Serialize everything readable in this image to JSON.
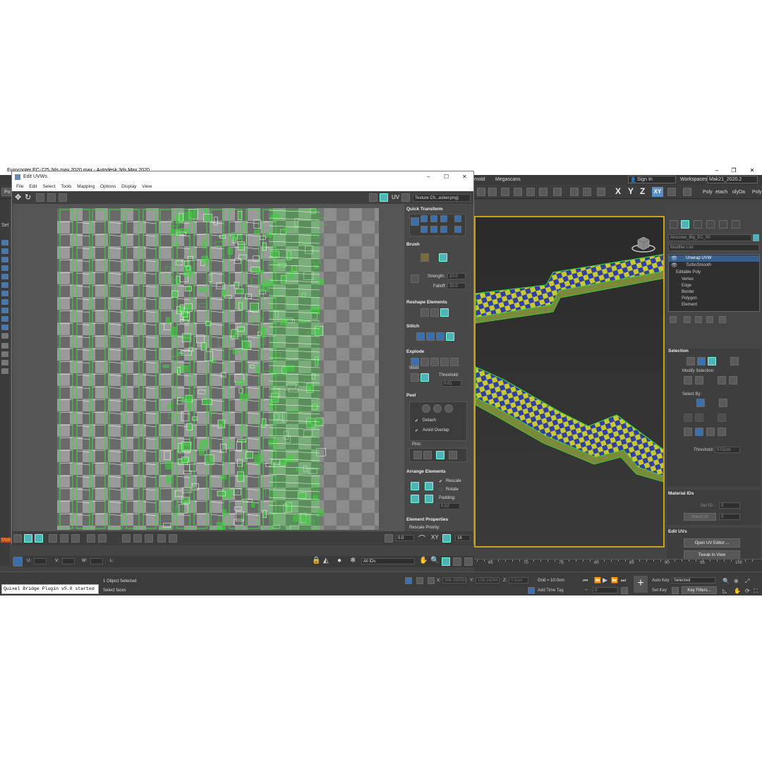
{
  "main_window": {
    "title": "Eurocopter EC-725 3ds max 2020.max - Autodesk 3ds Max 2020",
    "menu_tail": [
      "rnold",
      "Megascans"
    ],
    "sign_in": "Sign In",
    "workspaces_label": "Workspaces:",
    "workspace_value": "Mak21_2020.2",
    "axis_buttons": [
      "X",
      "Y",
      "Z",
      "XY"
    ],
    "ribbon_tabs": [
      "Poly",
      "etach",
      "olyDa",
      "Poly"
    ],
    "left_tab_label": "Po",
    "left_sel_label": "Sel",
    "left_mak_label": "Mak"
  },
  "command_panel": {
    "object_name": "Airscrew_Big_EC_00",
    "modifier_list_label": "Modifier List",
    "stack": [
      "Unwrap UVW",
      "TurboSmooth",
      "Editable Poly",
      "Vertex",
      "Edge",
      "Border",
      "Polygon",
      "Element"
    ],
    "selection": {
      "title": "Selection",
      "modify_selection": "Modify Selection:",
      "select_by": "Select By:",
      "threshold_label": "Threshold:",
      "threshold_value": "0.01cm"
    },
    "material_ids": {
      "title": "Material IDs",
      "set_id": "Set ID:",
      "select_id": "Select ID",
      "val": "0"
    },
    "edit_uvs": {
      "title": "Edit UVs",
      "open_editor": "Open UV Editor ...",
      "tweak": "Tweak In View"
    }
  },
  "uvw_editor": {
    "title": "Edit UVWs",
    "menu": [
      "File",
      "Edit",
      "Select",
      "Tools",
      "Mapping",
      "Options",
      "Display",
      "View"
    ],
    "uv_label": "UV",
    "texture_dropdown": "Texture Ch...ecker.png)",
    "panel": {
      "quick_transform": "Quick Transform",
      "brush": "Brush",
      "strength_label": "Strength:",
      "strength_value": "10.0",
      "falloff_label": "Falloff:",
      "falloff_value": "20.0",
      "reshape": "Reshape Elements",
      "stitch": "Stitch",
      "explode": "Explode",
      "weld": "Weld",
      "threshold_label": "Threshold:",
      "threshold_value": "0.01",
      "peel": "Peel",
      "detach": "Detach",
      "avoid_overlap": "Avoid Overlap",
      "pins": "Pins:",
      "arrange": "Arrange Elements",
      "rescale": "Rescale",
      "rotate": "Rotate",
      "padding_label": "Padding:",
      "padding_value": "0.02",
      "element_props": "Element Properties",
      "rescale_priority": "Rescale Priority:",
      "groups": "Groups:"
    },
    "bottom": {
      "value": "0.0",
      "xy": "XY",
      "num": "16",
      "u": "U:",
      "v": "V:",
      "w": "W:",
      "l": "L:",
      "all_ids": "All IDs"
    }
  },
  "timeline": {
    "ticks": [
      "65",
      "70",
      "75",
      "80",
      "85",
      "90",
      "95",
      "100"
    ]
  },
  "status_bar": {
    "quixel": "Quixel Bridge Plugin v5.0 started",
    "objects_selected": "1 Object Selected",
    "prompt": "Select faces",
    "x_label": "X:",
    "x_value": "366.39559c",
    "y_label": "Y:",
    "y_value": "108.14264",
    "z_label": "Z:",
    "z_value": "0.0cm",
    "grid": "Grid = 10.0cm",
    "add_time_tag": "Add Time Tag",
    "auto_key": "Auto Key",
    "set_key": "Set Key",
    "selected": "Selected",
    "key_filters": "Key Filters...",
    "frame": "0"
  },
  "colors": {
    "accent_teal": "#4fb3b8",
    "viewport_border": "#c9a21c",
    "uv_wire": "#3cd23c",
    "mesh_yellow": "#c8c832",
    "mesh_blue": "#3040a0"
  }
}
